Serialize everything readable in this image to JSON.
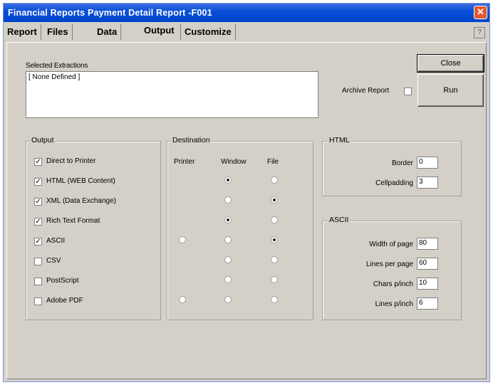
{
  "window": {
    "title": "Financial Reports  Payment Detail Report -F001",
    "close_glyph": "✕",
    "help_glyph": "?"
  },
  "tabs": [
    {
      "label": "Report"
    },
    {
      "label": "Files"
    },
    {
      "label": "Data"
    },
    {
      "label": "Output",
      "active": true
    },
    {
      "label": "Customize"
    }
  ],
  "selected_extractions": {
    "label": "Selected Extractions",
    "value": "[ None Defined ]"
  },
  "buttons": {
    "close": "Close",
    "run": "Run"
  },
  "archive": {
    "label": "Archive Report",
    "checked": false
  },
  "output_group": {
    "label": "Output",
    "items": [
      {
        "label": "Direct to Printer",
        "checked": true
      },
      {
        "label": "HTML (WEB Content)",
        "checked": true
      },
      {
        "label": "XML (Data Exchange)",
        "checked": true
      },
      {
        "label": "Rich Text Format",
        "checked": true
      },
      {
        "label": "ASCII",
        "checked": true
      },
      {
        "label": "CSV",
        "checked": false
      },
      {
        "label": "PostScript",
        "checked": false
      },
      {
        "label": "Adobe PDF",
        "checked": false
      }
    ]
  },
  "destination_group": {
    "label": "Destination",
    "columns": [
      "Printer",
      "Window",
      "File"
    ],
    "rows": [
      {
        "printer": null,
        "window": "on",
        "file": "off"
      },
      {
        "printer": null,
        "window": "off",
        "file": "on"
      },
      {
        "printer": null,
        "window": "on",
        "file": "off"
      },
      {
        "printer": null,
        "window": "off",
        "file": "off"
      },
      {
        "printer": "off",
        "window": "off",
        "file": "on"
      },
      {
        "printer": null,
        "window": "off",
        "file": "off"
      },
      {
        "printer": null,
        "window": "off",
        "file": "off"
      },
      {
        "printer": "off",
        "window": "off",
        "file": "off"
      }
    ]
  },
  "html_group": {
    "label": "HTML",
    "border_label": "Border",
    "border_value": "0",
    "cellpadding_label": "Cellpadding",
    "cellpadding_value": "3"
  },
  "ascii_group": {
    "label": "ASCII",
    "fields": [
      {
        "label": "Width of page",
        "value": "80"
      },
      {
        "label": "Lines per page",
        "value": "60"
      },
      {
        "label": "Chars p/inch",
        "value": "10"
      },
      {
        "label": "Lines p/inch",
        "value": "6"
      }
    ]
  }
}
